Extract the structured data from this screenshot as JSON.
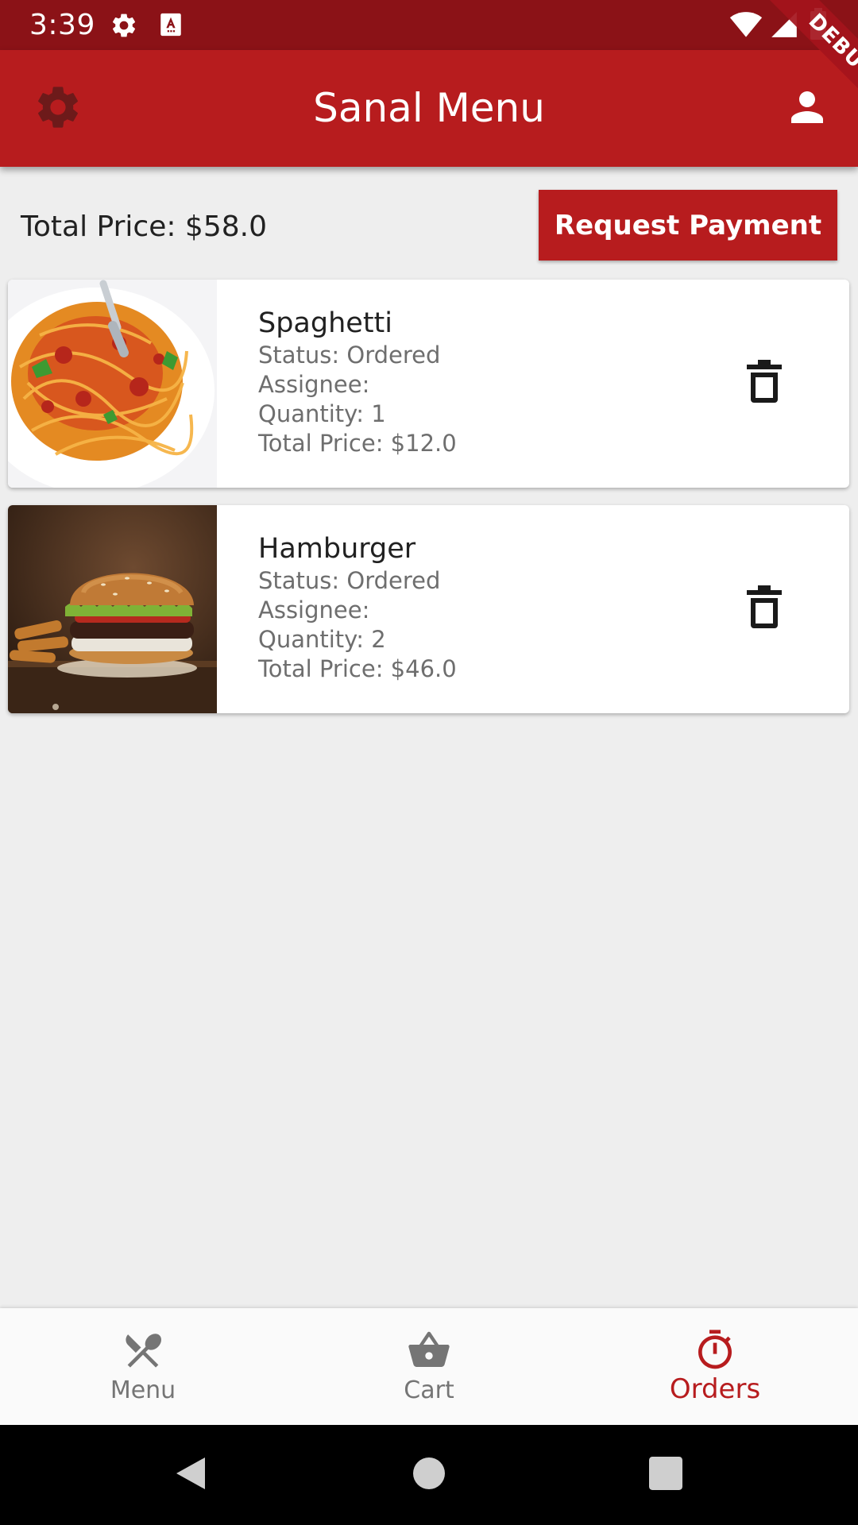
{
  "status_bar": {
    "time": "3:39",
    "left_icons": [
      "settings-icon",
      "text-a-icon"
    ],
    "right_icons": [
      "wifi-icon",
      "signal-icon",
      "battery-icon"
    ]
  },
  "debug_banner": {
    "text": "DEBUG"
  },
  "app_bar": {
    "title": "Sanal Menu",
    "left_icon": "gear-icon",
    "right_icon": "person-icon",
    "background_color": "#b71c1e"
  },
  "summary": {
    "total_price_text": "Total Price: $58.0",
    "request_payment_label": "Request Payment"
  },
  "orders": [
    {
      "name": "Spaghetti",
      "status": "Status: Ordered",
      "assignee": "Assignee:",
      "quantity": "Quantity: 1",
      "total_price": "Total Price: $12.0",
      "image": "spaghetti-photo",
      "action_icon": "trash-icon"
    },
    {
      "name": "Hamburger",
      "status": "Status: Ordered",
      "assignee": "Assignee:",
      "quantity": "Quantity: 2",
      "total_price": "Total Price: $46.0",
      "image": "hamburger-photo",
      "action_icon": "trash-icon"
    }
  ],
  "bottom_nav": {
    "items": [
      {
        "label": "Menu",
        "icon": "fork-knife-icon",
        "active": false
      },
      {
        "label": "Cart",
        "icon": "basket-icon",
        "active": false
      },
      {
        "label": "Orders",
        "icon": "timer-icon",
        "active": true
      }
    ],
    "active_color": "#b71c1e",
    "inactive_color": "#757575"
  },
  "system_nav": {
    "buttons": [
      "back-icon",
      "home-icon",
      "recents-icon"
    ]
  }
}
